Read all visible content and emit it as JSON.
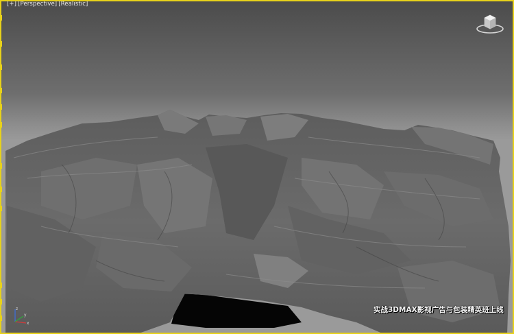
{
  "viewport": {
    "label_parts": [
      "[+]",
      "[Perspective]",
      "[Realistic]"
    ],
    "active_border_color": "#e8d21a",
    "background_top": "#4b4b4b",
    "background_bottom": "#9a9a9a"
  },
  "viewcube": {
    "icon": "viewcube-icon"
  },
  "axis_tripod": {
    "icon": "axis-tripod-icon",
    "x_label": "x",
    "y_label": "y",
    "z_label": "z"
  },
  "scene": {
    "object": "terrain-mesh"
  },
  "watermark": {
    "text": "实战3DMAX影视广告与包装精英班上线"
  }
}
